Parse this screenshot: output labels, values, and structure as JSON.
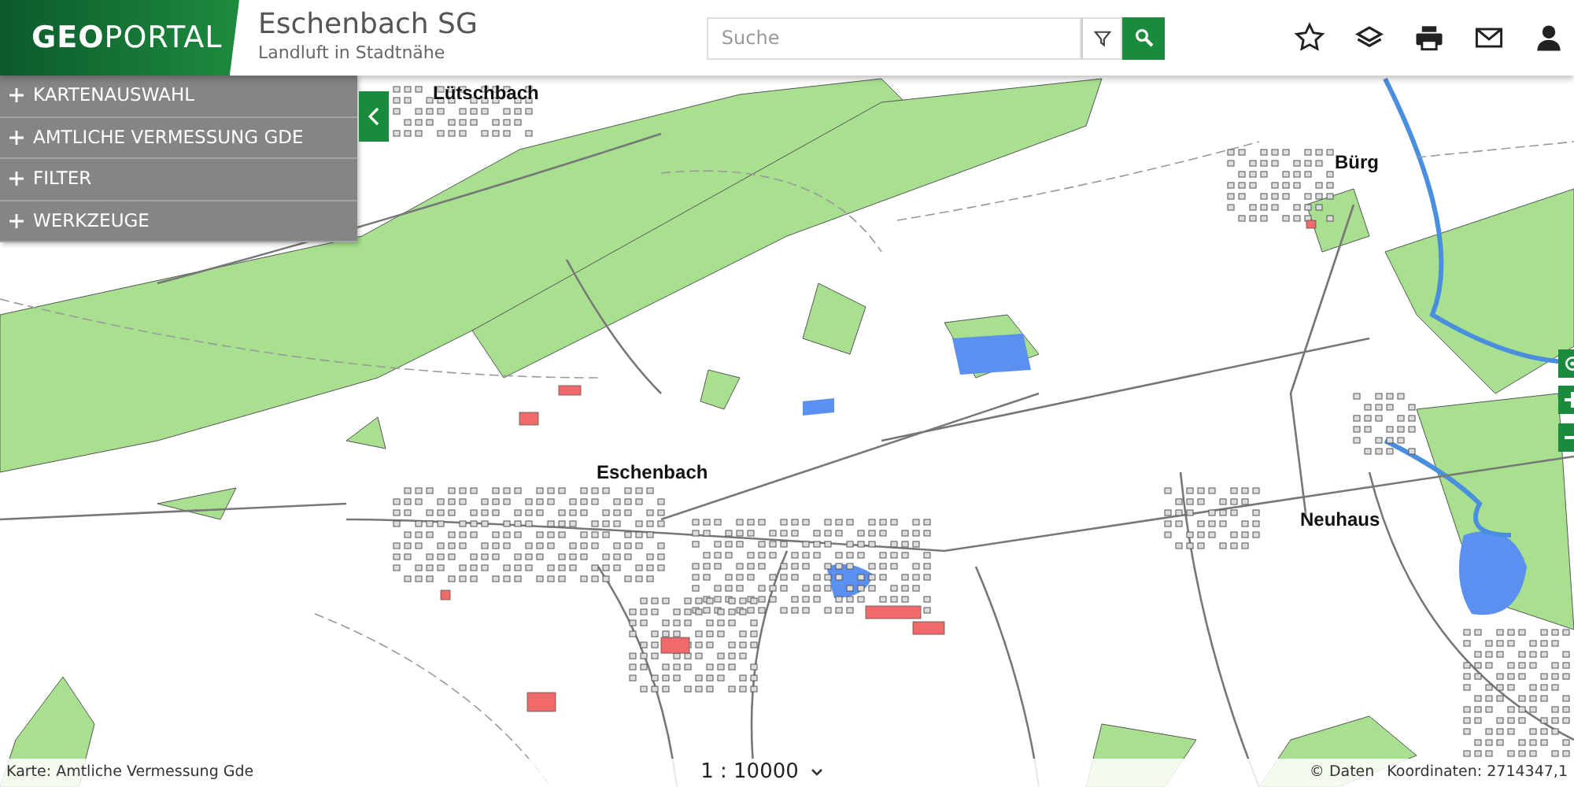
{
  "header": {
    "logo": "**GEO**PORTAL",
    "title": "Eschenbach SG",
    "subtitle": "Landluft in Stadtnähe"
  },
  "search": {
    "placeholder": "Suche"
  },
  "sidebar": {
    "collapsed": false,
    "items": [
      {
        "label": "KARTENAUSWAHL",
        "expanded": false
      },
      {
        "label": "AMTLICHE VERMESSUNG GDE",
        "expanded": false
      },
      {
        "label": "FILTER",
        "expanded": false
      },
      {
        "label": "WERKZEUGE",
        "expanded": false
      }
    ]
  },
  "map": {
    "places": [
      {
        "name": "Lütschbach"
      },
      {
        "name": "Bürg"
      },
      {
        "name": "Eschenbach"
      },
      {
        "name": "Neuhaus"
      }
    ]
  },
  "status_bar": {
    "map_name": "Karte: Amtliche Vermessung Gde",
    "scale": "1 : 10000",
    "copyright": "© Daten",
    "coordinates": "Koordinaten: 2714347,1"
  }
}
